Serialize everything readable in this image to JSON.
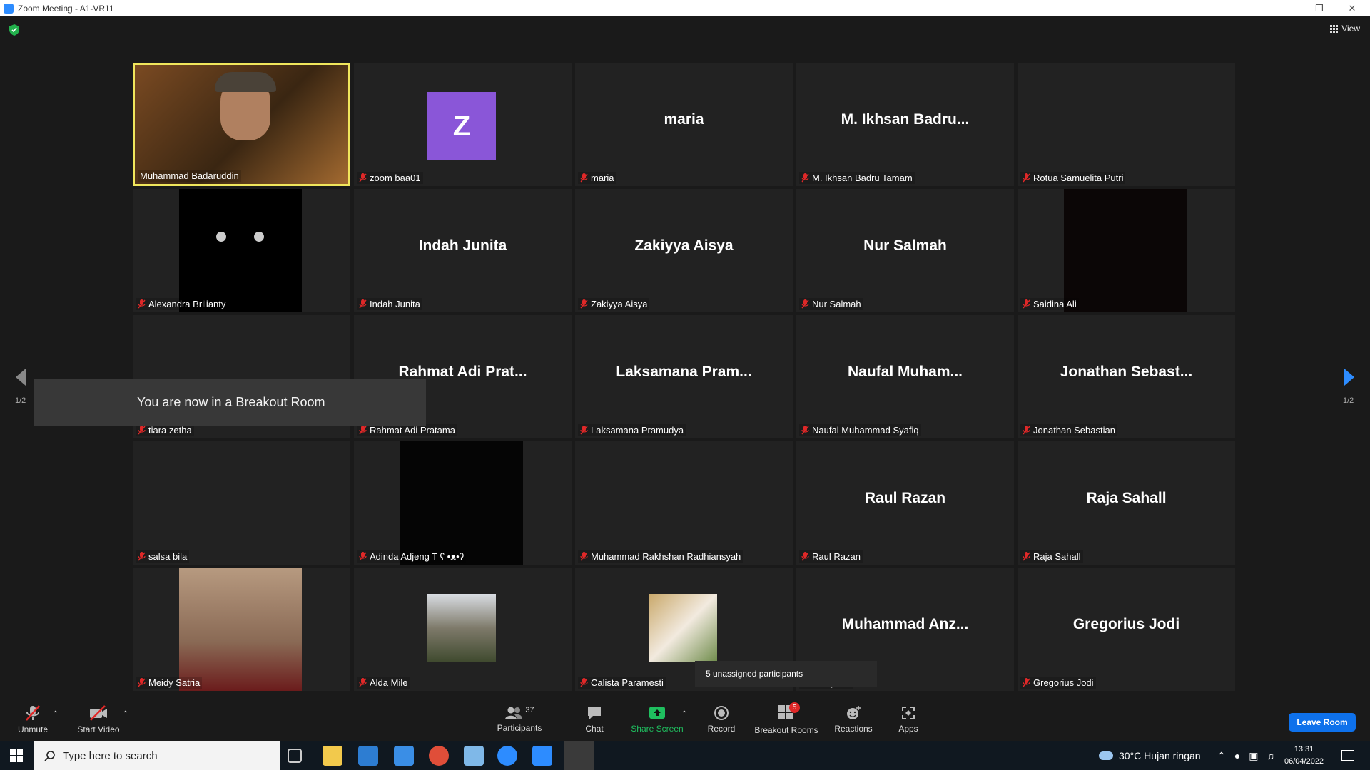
{
  "window": {
    "title": "Zoom Meeting - A1-VR11",
    "minimize_icon": "minimize-icon",
    "maximize_icon": "restore-icon",
    "close_icon": "close-icon"
  },
  "header": {
    "view_label": "View"
  },
  "pagination": {
    "left_page": "1/2",
    "right_page": "1/2"
  },
  "toast": {
    "text": "You are now in a Breakout Room"
  },
  "tooltip": {
    "text": "5 unassigned participants"
  },
  "tiles": [
    {
      "label": "Muhammad Badaruddin",
      "big": ""
    },
    {
      "label": "zoom baa01",
      "big": "",
      "avatar": "Z"
    },
    {
      "label": "maria",
      "big": "maria"
    },
    {
      "label": "M. Ikhsan Badru Tamam",
      "big": "M. Ikhsan Badru..."
    },
    {
      "label": "Rotua Samuelita Putri",
      "big": ""
    },
    {
      "label": "Alexandra Brilianty",
      "big": ""
    },
    {
      "label": "Indah Junita",
      "big": "Indah Junita"
    },
    {
      "label": "Zakiyya Aisya",
      "big": "Zakiyya Aisya"
    },
    {
      "label": "Nur Salmah",
      "big": "Nur Salmah"
    },
    {
      "label": "Saidina Ali",
      "big": ""
    },
    {
      "label": "tiara zetha",
      "big": ""
    },
    {
      "label": "Rahmat Adi Pratama",
      "big": "Rahmat Adi Prat..."
    },
    {
      "label": "Laksamana Pramudya",
      "big": "Laksamana Pram..."
    },
    {
      "label": "Naufal Muhammad Syafiq",
      "big": "Naufal Muham..."
    },
    {
      "label": "Jonathan Sebastian",
      "big": "Jonathan Sebast..."
    },
    {
      "label": "salsa bila",
      "big": ""
    },
    {
      "label": "Adinda Adjeng T ʕ •ᴥ•ʔ",
      "big": ""
    },
    {
      "label": "Muhammad Rakhshan Radhiansyah",
      "big": ""
    },
    {
      "label": "Raul Razan",
      "big": "Raul Razan"
    },
    {
      "label": "Raja Sahall",
      "big": "Raja Sahall"
    },
    {
      "label": "Meidy Satria",
      "big": ""
    },
    {
      "label": "Alda Mile",
      "big": ""
    },
    {
      "label": "Calista Paramesti",
      "big": ""
    },
    {
      "label": "za Djumri",
      "big": "Muhammad Anz..."
    },
    {
      "label": "Gregorius Jodi",
      "big": "Gregorius Jodi"
    }
  ],
  "toolbar": {
    "unmute": "Unmute",
    "start_video": "Start Video",
    "participants": "Participants",
    "participants_count": "37",
    "chat": "Chat",
    "share_screen": "Share Screen",
    "record": "Record",
    "breakout_rooms": "Breakout Rooms",
    "breakout_badge": "5",
    "reactions": "Reactions",
    "apps": "Apps",
    "leave_room": "Leave Room"
  },
  "taskbar": {
    "search_placeholder": "Type here to search",
    "weather": "30°C  Hujan ringan",
    "time": "13:31",
    "date": "06/04/2022"
  },
  "colors": {
    "active_speaker": "#f0e65c",
    "share_green": "#1fbf5f",
    "leave_blue": "#0e71eb",
    "mic_off_red": "#e02828",
    "avatar_purple": "#8a56d8"
  }
}
